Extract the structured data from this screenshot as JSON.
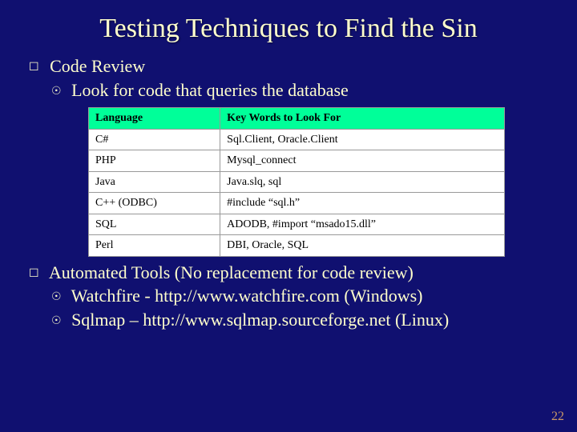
{
  "title": "Testing Techniques to Find the Sin",
  "bullets": {
    "a1": "Code Review",
    "a2": "Look for code that queries the database",
    "b1": "Automated Tools (No replacement for code review)",
    "b2": "Watchfire - http://www.watchfire.com (Windows)",
    "b3": "Sqlmap – http://www.sqlmap.sourceforge.net (Linux)"
  },
  "table": {
    "headers": [
      "Language",
      "Key Words to Look For"
    ],
    "rows": [
      [
        "C#",
        "Sql.Client, Oracle.Client"
      ],
      [
        "PHP",
        "Mysql_connect"
      ],
      [
        "Java",
        "Java.slq, sql"
      ],
      [
        "C++ (ODBC)",
        "#include “sql.h”"
      ],
      [
        "SQL",
        "ADODB, #import “msado15.dll”"
      ],
      [
        "Perl",
        "DBI, Oracle, SQL"
      ]
    ]
  },
  "page_number": "22"
}
